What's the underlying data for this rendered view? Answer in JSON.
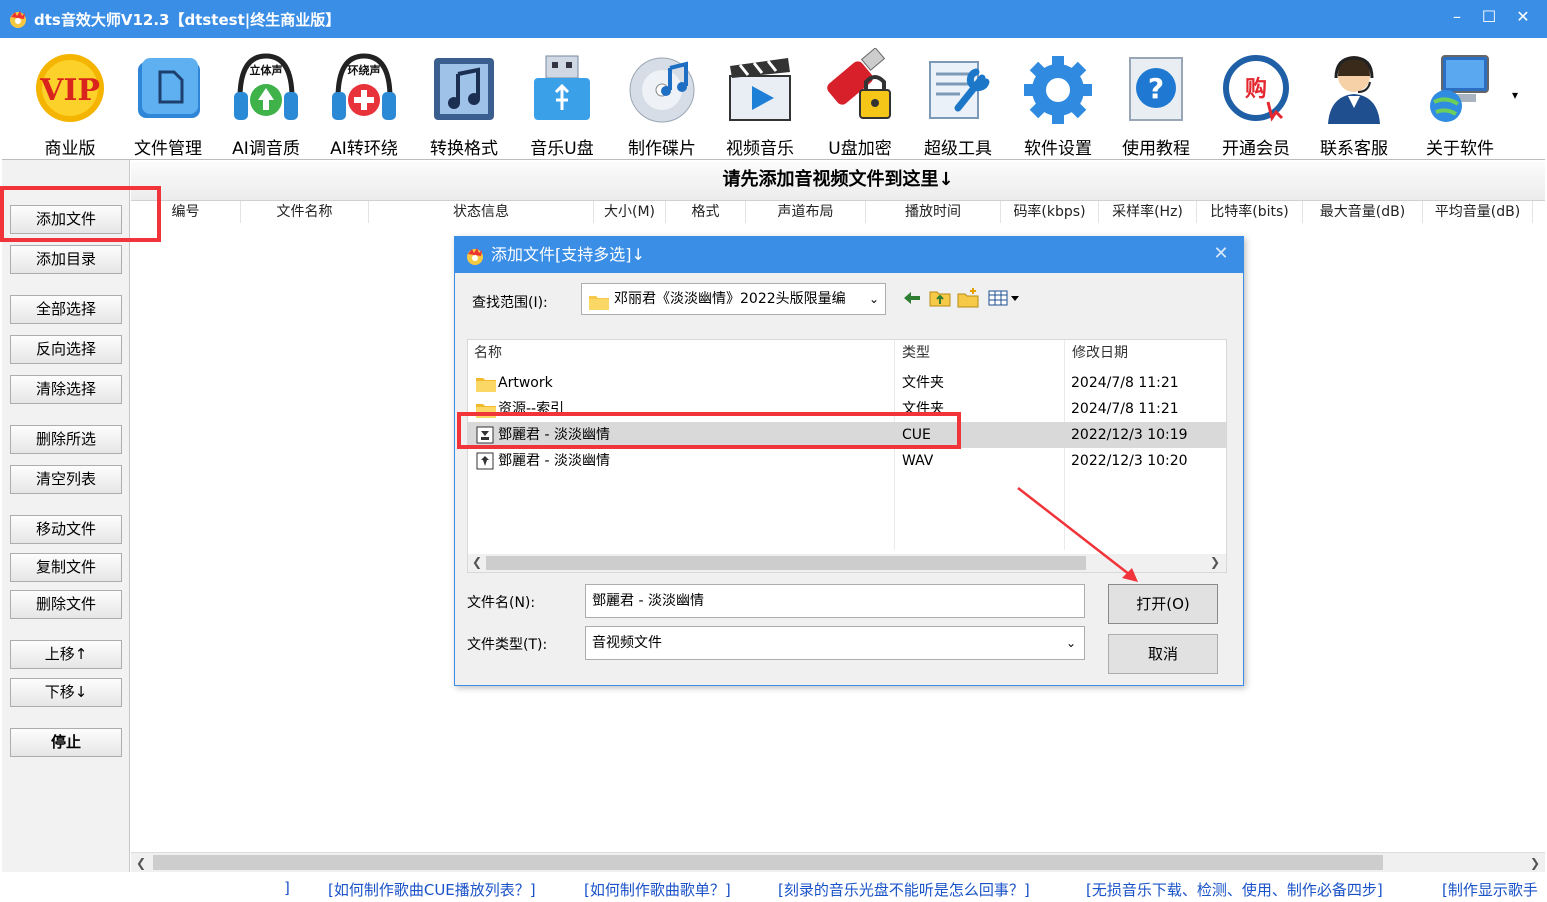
{
  "window": {
    "title": "dts音效大师V12.3【dtstest|终生商业版】",
    "minimize": "–",
    "maximize": "☐",
    "close": "✕"
  },
  "toolbar": {
    "items": [
      {
        "label": "商业版",
        "icon": "vip-icon"
      },
      {
        "label": "文件管理",
        "icon": "file-manager-icon"
      },
      {
        "label": "AI调音质",
        "icon": "stereo-headphones-icon",
        "badge": "立体声"
      },
      {
        "label": "AI转环绕",
        "icon": "surround-headphones-icon",
        "badge": "环绕声"
      },
      {
        "label": "转换格式",
        "icon": "music-note-icon"
      },
      {
        "label": "音乐U盘",
        "icon": "usb-drive-icon"
      },
      {
        "label": "制作碟片",
        "icon": "disc-icon"
      },
      {
        "label": "视频音乐",
        "icon": "video-clapper-icon"
      },
      {
        "label": "U盘加密",
        "icon": "usb-lock-icon"
      },
      {
        "label": "超级工具",
        "icon": "tools-icon"
      },
      {
        "label": "软件设置",
        "icon": "settings-gear-icon"
      },
      {
        "label": "使用教程",
        "icon": "help-icon"
      },
      {
        "label": "开通会员",
        "icon": "shop-icon",
        "badge": "购"
      },
      {
        "label": "联系客服",
        "icon": "customer-service-icon"
      },
      {
        "label": "关于软件",
        "icon": "about-computer-icon"
      }
    ],
    "more": "▾"
  },
  "sidebar": {
    "buttons": [
      "添加文件",
      "添加目录",
      "全部选择",
      "反向选择",
      "清除选择",
      "删除所选",
      "清空列表",
      "移动文件",
      "复制文件",
      "删除文件",
      "上移↑",
      "下移↓",
      "停止"
    ]
  },
  "main": {
    "banner": "请先添加音视频文件到这里↓",
    "columns": [
      "编号",
      "文件名称",
      "状态信息",
      "大小(M)",
      "格式",
      "声道布局",
      "播放时间",
      "码率(kbps)",
      "采样率(Hz)",
      "比特率(bits)",
      "最大音量(dB)",
      "平均音量(dB)"
    ]
  },
  "status_links": [
    "]",
    "[如何制作歌曲CUE播放列表？]",
    "[如何制作歌曲歌单？]",
    "[刻录的音乐光盘不能听是怎么回事？]",
    "[无损音乐下载、检测、使用、制作必备四步]",
    "[制作显示歌手"
  ],
  "dialog": {
    "title": "添加文件[支持多选]↓",
    "close": "✕",
    "lookin_label": "查找范围(I):",
    "lookin_value": "邓丽君《淡淡幽情》2022头版限量编",
    "list_headers": {
      "name": "名称",
      "type": "类型",
      "date": "修改日期"
    },
    "files": [
      {
        "name": "Artwork",
        "type": "文件夹",
        "date": "2024/7/8 11:21",
        "kind": "folder"
      },
      {
        "name": "资源--索引",
        "type": "文件夹",
        "date": "2024/7/8 11:21",
        "kind": "folder"
      },
      {
        "name": "鄧麗君 - 淡淡幽情",
        "type": "CUE",
        "date": "2022/12/3 10:19",
        "kind": "cue"
      },
      {
        "name": "鄧麗君 - 淡淡幽情",
        "type": "WAV",
        "date": "2022/12/3 10:20",
        "kind": "wav"
      }
    ],
    "filename_label": "文件名(N):",
    "filename_value": "鄧麗君 - 淡淡幽情",
    "filetype_label": "文件类型(T):",
    "filetype_value": "音视频文件",
    "open_button": "打开(O)",
    "cancel_button": "取消"
  },
  "colors": {
    "titlebar": "#3a8ee6",
    "highlight": "#f0343a",
    "link": "#1a53c7"
  }
}
